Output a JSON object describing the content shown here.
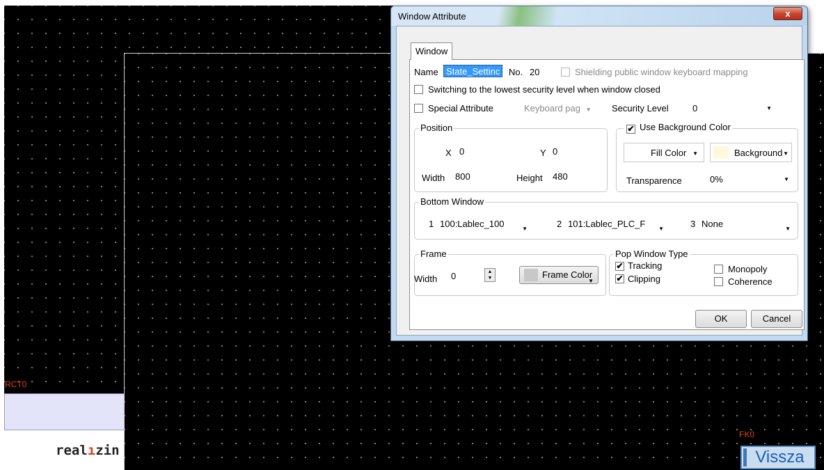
{
  "canvas": {
    "back_label": "RCT0",
    "front_label": "FK0",
    "logo_text_pre": "real",
    "logo_text_accent": "ı",
    "logo_text_post": "zin",
    "vissza_label": "Vissza"
  },
  "dialog": {
    "title": "Window Attribute",
    "close_glyph": "x",
    "tab_label": "Window",
    "name_label": "Name",
    "name_value": "State_Settinc",
    "no_label": "No.",
    "no_value": "20",
    "shielding_label": "Shielding public window keyboard mapping",
    "shielding_checked": false,
    "switch_lowest_label": "Switching to the lowest security level when window closed",
    "switch_lowest_checked": false,
    "special_attr_label": "Special Attribute",
    "special_attr_checked": false,
    "special_attr_select": "Keyboard pag",
    "security_level_label": "Security Level",
    "security_level_value": "0",
    "position": {
      "legend": "Position",
      "x_label": "X",
      "x_value": "0",
      "y_label": "Y",
      "y_value": "0",
      "width_label": "Width",
      "width_value": "800",
      "height_label": "Height",
      "height_value": "480"
    },
    "background": {
      "use_bg_label": "Use Background Color",
      "use_bg_checked": true,
      "fill_color_label": "Fill Color",
      "background_label": "Background",
      "transparence_label": "Transparence",
      "transparence_value": "0%",
      "fill_swatch_color": "#ffffff",
      "bg_swatch_color": "#fff8dc"
    },
    "bottom_window": {
      "legend": "Bottom Window",
      "slot1_num": "1",
      "slot1_value": "100:Lablec_100",
      "slot2_num": "2",
      "slot2_value": "101:Lablec_PLC_F",
      "slot3_num": "3",
      "slot3_value": "None"
    },
    "frame": {
      "legend": "Frame",
      "width_label": "Width",
      "width_value": "0",
      "frame_color_label": "Frame Color",
      "frame_swatch_color": "#c8c8c8"
    },
    "pop_type": {
      "legend": "Pop Window Type",
      "tracking_label": "Tracking",
      "tracking_checked": true,
      "clipping_label": "Clipping",
      "clipping_checked": true,
      "monopoly_label": "Monopoly",
      "monopoly_checked": false,
      "coherence_label": "Coherence",
      "coherence_checked": false
    },
    "ok_label": "OK",
    "cancel_label": "Cancel"
  }
}
